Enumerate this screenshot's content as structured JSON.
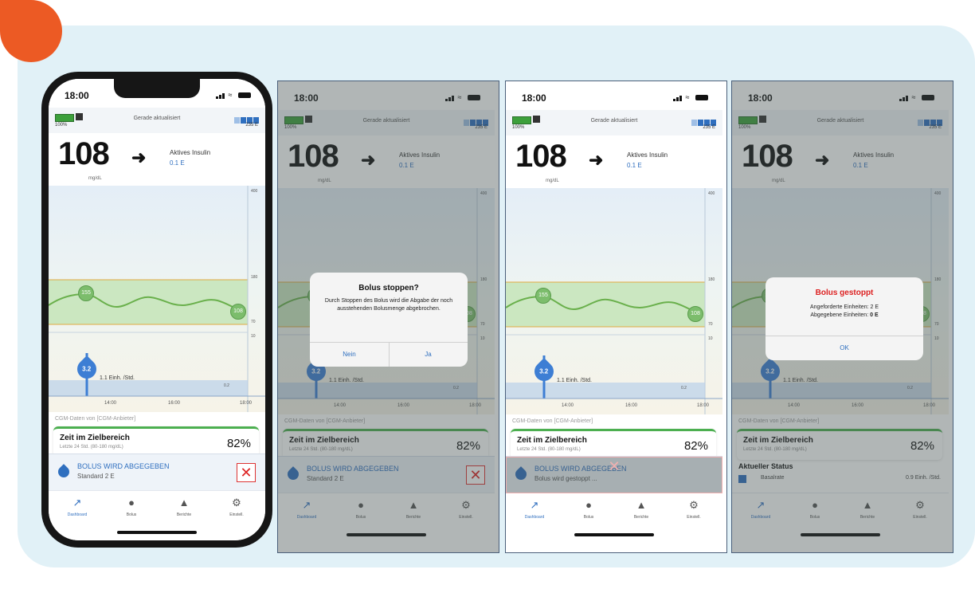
{
  "colors": {
    "panel_bg": "#e1f1f7",
    "accent_orange": "#ec5a24",
    "brand_blue": "#2f6fbf",
    "in_range_green": "#4caf50",
    "stop_red": "#d22"
  },
  "common": {
    "time": "18:00",
    "pump_battery_pct": "100%",
    "updated": "Gerade aktualisiert",
    "reservoir_units": "235 E",
    "glucose_value": "108",
    "glucose_unit": "mg/dL",
    "trend_icon": "arrow-right",
    "active_insulin_label": "Aktives Insulin",
    "active_insulin_value": "0.1 E",
    "graph": {
      "y_labels": [
        "400",
        "180",
        "70",
        "10",
        "0.2"
      ],
      "x_ticks": [
        "14:00",
        "16:00",
        "18:00"
      ],
      "peak_badge": "155",
      "current_badge": "108",
      "bolus_drop": "3.2",
      "basal_rate": "1.1 Einh. /Std."
    },
    "cgm_source": "CGM-Daten von [CGM-Anbieter]",
    "tir_title": "Zeit im Zielbereich",
    "tir_sub": "Letzte 24 Std. (80-180 mg/dL)",
    "tir_pct": "82%",
    "bolus_title": "BOLUS WIRD ABGEGEBEN",
    "bolus_sub": "Standard 2 E",
    "stop_icon": "close-icon",
    "tabs": [
      {
        "label": "Dashboard",
        "icon": "chart-icon"
      },
      {
        "label": "Bolus",
        "icon": "drop-icon"
      },
      {
        "label": "Berichte",
        "icon": "bell-icon"
      },
      {
        "label": "Einstell.",
        "icon": "gear-icon"
      }
    ]
  },
  "screen2": {
    "dialog_title": "Bolus stoppen?",
    "dialog_body": "Durch Stoppen des Bolus wird die Abgabe der noch ausstehenden Bolusmenge abgebrochen.",
    "btn_no": "Nein",
    "btn_yes": "Ja"
  },
  "screen3": {
    "bolus_sub": "Bolus wird gestoppt ..."
  },
  "screen4": {
    "dialog_title": "Bolus gestoppt",
    "line1": "Angeforderte Einheiten: 2 E",
    "line2_label": "Abgegebene Einheiten:",
    "line2_value": "0 E",
    "btn_ok": "OK",
    "status_title": "Aktueller Status",
    "status_text": "Basalrate",
    "status_value": "0.9 Einh. /Std."
  }
}
